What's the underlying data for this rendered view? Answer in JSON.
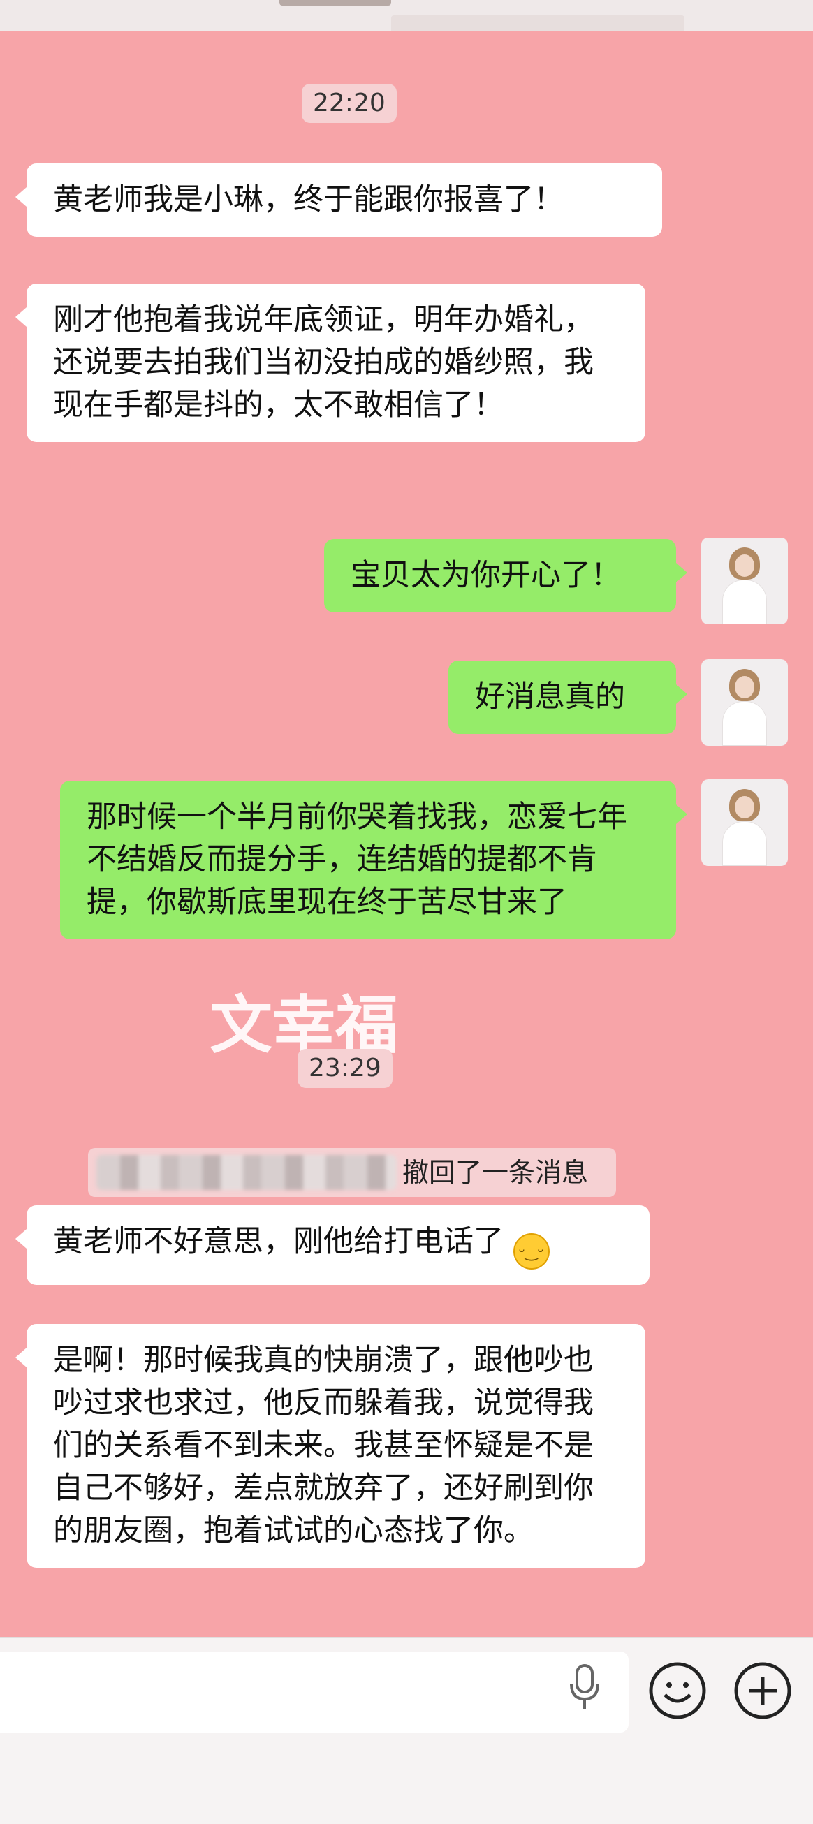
{
  "chat": {
    "times": [
      "22:20",
      "23:29"
    ],
    "messages": [
      {
        "side": "left",
        "text": "黄老师我是小琳，终于能跟你报喜了！"
      },
      {
        "side": "left",
        "text": "刚才他抱着我说年底领证，明年办婚礼，还说要去拍我们当初没拍成的婚纱照，我现在手都是抖的，太不敢相信了！"
      },
      {
        "side": "right",
        "text": "宝贝太为你开心了！"
      },
      {
        "side": "right",
        "text": "好消息真的"
      },
      {
        "side": "right",
        "text": "那时候一个半月前你哭着找我，恋爱七年不结婚反而提分手，连结婚的提都不肯提，你歇斯底里现在终于苦尽甘来了"
      },
      {
        "side": "left",
        "text": "黄老师不好意思，刚他给打电话了",
        "emoji": "grinning-face"
      },
      {
        "side": "left",
        "text": "是啊！那时候我真的快崩溃了，跟他吵也吵过求也求过，他反而躲着我，说觉得我们的关系看不到未来。我甚至怀疑是不是自己不够好，差点就放弃了，还好刷到你的朋友圈，抱着试试的心态找了你。"
      }
    ],
    "recall_notice": "撤回了一条消息",
    "watermark_text": "文幸福"
  },
  "colors": {
    "chat_background": "#f7a4a8",
    "left_bubble": "#ffffff",
    "right_bubble": "#95ec69"
  },
  "input_bar": {
    "icons": [
      "microphone-icon",
      "emoji-icon",
      "plus-icon"
    ]
  }
}
